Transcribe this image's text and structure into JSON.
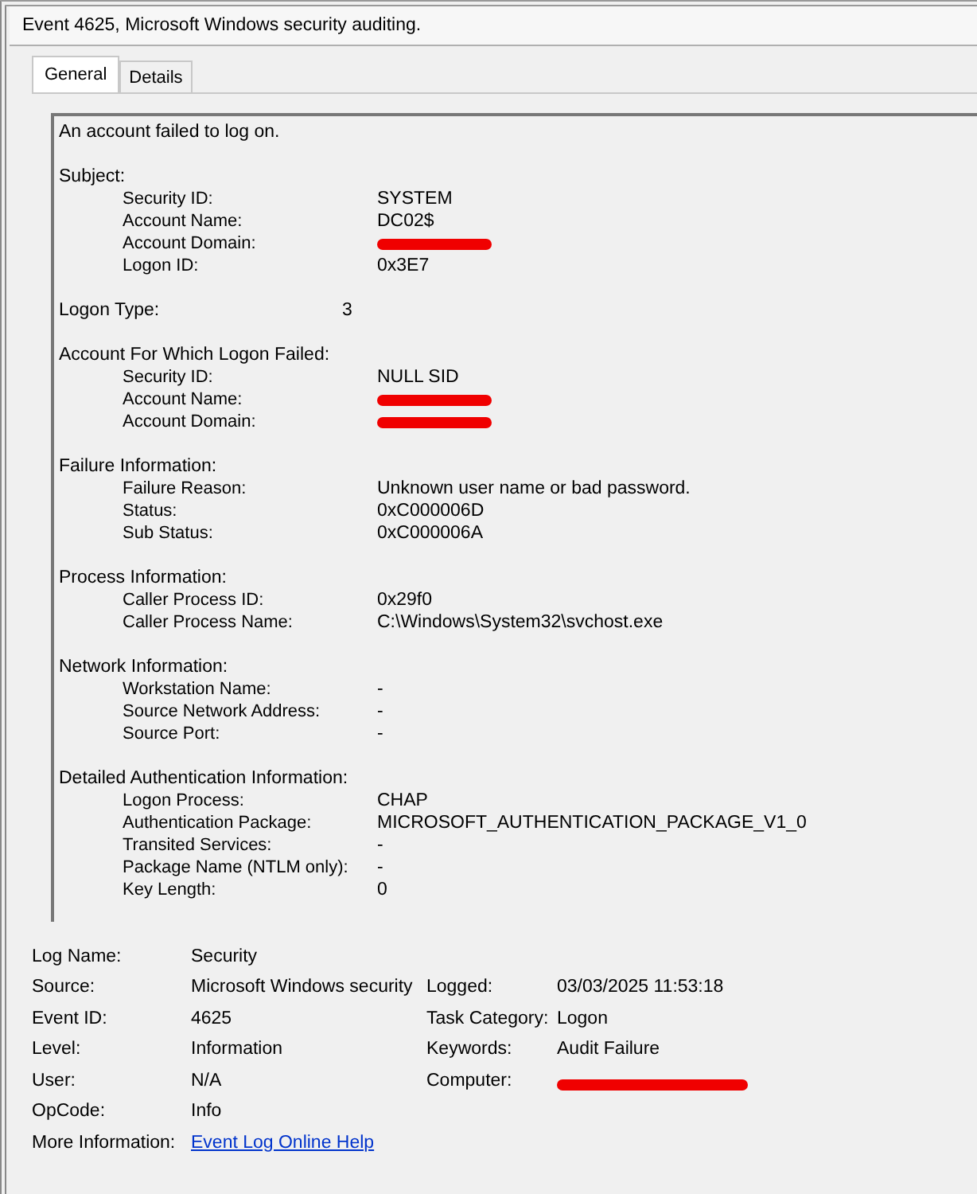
{
  "window": {
    "title": "Event 4625, Microsoft Windows security auditing."
  },
  "tabs": [
    {
      "label": "General",
      "selected": true
    },
    {
      "label": "Details",
      "selected": false
    }
  ],
  "description": {
    "summary": "An account failed to log on.",
    "sections": [
      {
        "kind": "group",
        "heading": "Subject:",
        "fields": [
          {
            "label": "Security ID:",
            "value": "SYSTEM",
            "redacted": false
          },
          {
            "label": "Account Name:",
            "value": "DC02$",
            "redacted": false
          },
          {
            "label": "Account Domain:",
            "redacted": true
          },
          {
            "label": "Logon ID:",
            "value": "0x3E7",
            "redacted": false
          }
        ]
      },
      {
        "kind": "line",
        "heading": "Logon Type:",
        "value": "3"
      },
      {
        "kind": "group",
        "heading": "Account For Which Logon Failed:",
        "fields": [
          {
            "label": "Security ID:",
            "value": "NULL SID",
            "redacted": false
          },
          {
            "label": "Account Name:",
            "redacted": true
          },
          {
            "label": "Account Domain:",
            "redacted": true
          }
        ]
      },
      {
        "kind": "group",
        "heading": "Failure Information:",
        "fields": [
          {
            "label": "Failure Reason:",
            "value": "Unknown user name or bad password.",
            "redacted": false
          },
          {
            "label": "Status:",
            "value": "0xC000006D",
            "redacted": false
          },
          {
            "label": "Sub Status:",
            "value": "0xC000006A",
            "redacted": false
          }
        ]
      },
      {
        "kind": "group",
        "heading": "Process Information:",
        "fields": [
          {
            "label": "Caller Process ID:",
            "value": "0x29f0",
            "redacted": false
          },
          {
            "label": "Caller Process Name:",
            "value": "C:\\Windows\\System32\\svchost.exe",
            "redacted": false
          }
        ]
      },
      {
        "kind": "group",
        "heading": "Network Information:",
        "fields": [
          {
            "label": "Workstation Name:",
            "value": "-",
            "redacted": false
          },
          {
            "label": "Source Network Address:",
            "value": "-",
            "redacted": false
          },
          {
            "label": "Source Port:",
            "value": "-",
            "redacted": false
          }
        ]
      },
      {
        "kind": "group",
        "heading": "Detailed Authentication Information:",
        "fields": [
          {
            "label": "Logon Process:",
            "value": "CHAP",
            "redacted": false
          },
          {
            "label": "Authentication Package:",
            "value": "MICROSOFT_AUTHENTICATION_PACKAGE_V1_0",
            "redacted": false
          },
          {
            "label": "Transited Services:",
            "value": "-",
            "redacted": false
          },
          {
            "label": "Package Name (NTLM only):",
            "value": "-",
            "redacted": false
          },
          {
            "label": "Key Length:",
            "value": "0",
            "redacted": false
          }
        ]
      }
    ]
  },
  "details": [
    {
      "left": {
        "label": "Log Name:",
        "value": "Security"
      }
    },
    {
      "left": {
        "label": "Source:",
        "value": "Microsoft Windows security"
      },
      "right": {
        "label": "Logged:",
        "value": "03/03/2025 11:53:18",
        "redacted": false
      }
    },
    {
      "left": {
        "label": "Event ID:",
        "value": "4625"
      },
      "right": {
        "label": "Task Category:",
        "value": "Logon",
        "redacted": false
      }
    },
    {
      "left": {
        "label": "Level:",
        "value": "Information"
      },
      "right": {
        "label": "Keywords:",
        "value": "Audit Failure",
        "redacted": false
      }
    },
    {
      "left": {
        "label": "User:",
        "value": "N/A"
      },
      "right": {
        "label": "Computer:",
        "redacted": true
      }
    },
    {
      "left": {
        "label": "OpCode:",
        "value": "Info"
      }
    },
    {
      "left": {
        "label": "More Information:",
        "value": "Event Log Online Help",
        "kind": "link"
      }
    }
  ]
}
